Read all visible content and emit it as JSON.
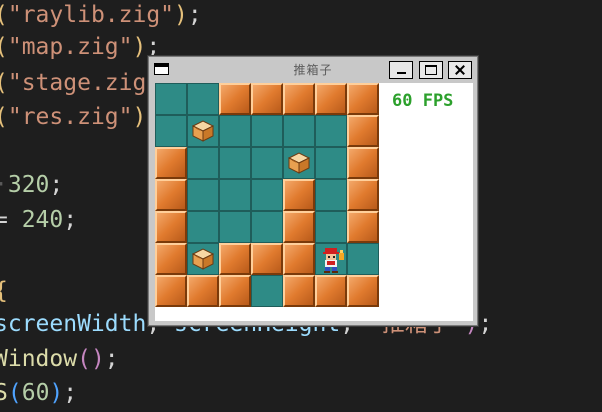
{
  "editor": {
    "lines": [
      {
        "parts": [
          {
            "t": "(",
            "c": "c-paren"
          },
          {
            "t": "\"raylib.zig\"",
            "c": "c-str"
          },
          {
            "t": ")",
            "c": "c-paren"
          },
          {
            "t": ";",
            "c": "c-plain"
          }
        ]
      },
      {
        "parts": [
          {
            "t": "(",
            "c": "c-paren"
          },
          {
            "t": "\"map.zig\"",
            "c": "c-str"
          },
          {
            "t": ")",
            "c": "c-paren"
          },
          {
            "t": ";",
            "c": "c-plain"
          }
        ]
      },
      {
        "parts": [
          {
            "t": "(",
            "c": "c-paren"
          },
          {
            "t": "\"stage.zig",
            "c": "c-str"
          }
        ]
      },
      {
        "parts": [
          {
            "t": "(",
            "c": "c-paren"
          },
          {
            "t": "\"res.zig\"",
            "c": "c-str"
          },
          {
            "t": ")",
            "c": "c-paren"
          }
        ]
      },
      {
        "parts": []
      },
      {
        "parts": [
          {
            "t": "·",
            "c": "c-dot"
          },
          {
            "t": "320",
            "c": "c-num"
          },
          {
            "t": ";",
            "c": "c-plain"
          }
        ]
      },
      {
        "parts": [
          {
            "t": "= ",
            "c": "c-plain"
          },
          {
            "t": "240",
            "c": "c-num"
          },
          {
            "t": ";",
            "c": "c-plain"
          }
        ]
      },
      {
        "parts": []
      },
      {
        "parts": [
          {
            "t": "{",
            "c": "c-paren"
          }
        ]
      },
      {
        "parts": [
          {
            "t": "screenWidth",
            "c": "c-var"
          },
          {
            "t": ", ",
            "c": "c-plain"
          },
          {
            "t": "screenHeight",
            "c": "c-var"
          },
          {
            "t": ", ",
            "c": "c-plain"
          },
          {
            "t": "\"推箱子\"",
            "c": "c-str"
          },
          {
            "t": ")",
            "c": "c-paren2"
          },
          {
            "t": ";",
            "c": "c-plain"
          }
        ]
      },
      {
        "parts": [
          {
            "t": "Window",
            "c": "c-fn"
          },
          {
            "t": "()",
            "c": "c-paren2"
          },
          {
            "t": ";",
            "c": "c-plain"
          }
        ]
      },
      {
        "parts": [
          {
            "t": "S",
            "c": "c-fn"
          },
          {
            "t": "(",
            "c": "c-paren3"
          },
          {
            "t": "60",
            "c": "c-num"
          },
          {
            "t": ")",
            "c": "c-paren3"
          },
          {
            "t": ";",
            "c": "c-plain"
          }
        ]
      }
    ]
  },
  "window": {
    "title": "推箱子",
    "fps_text": "60 FPS",
    "buttons": {
      "minimize": "minimize",
      "maximize": "maximize",
      "close": "close"
    }
  },
  "game": {
    "legend": {
      "W": "wall",
      "F": "floor",
      "B": "box-on-floor",
      "P": "player-on-floor",
      ".": "empty"
    },
    "grid": [
      "FFWWWWW",
      "FBFFFFW",
      "WFFFBFW",
      "WFFFWFW",
      "WFFFWFW",
      "WBWWWPF",
      "WWWFWWW"
    ]
  }
}
